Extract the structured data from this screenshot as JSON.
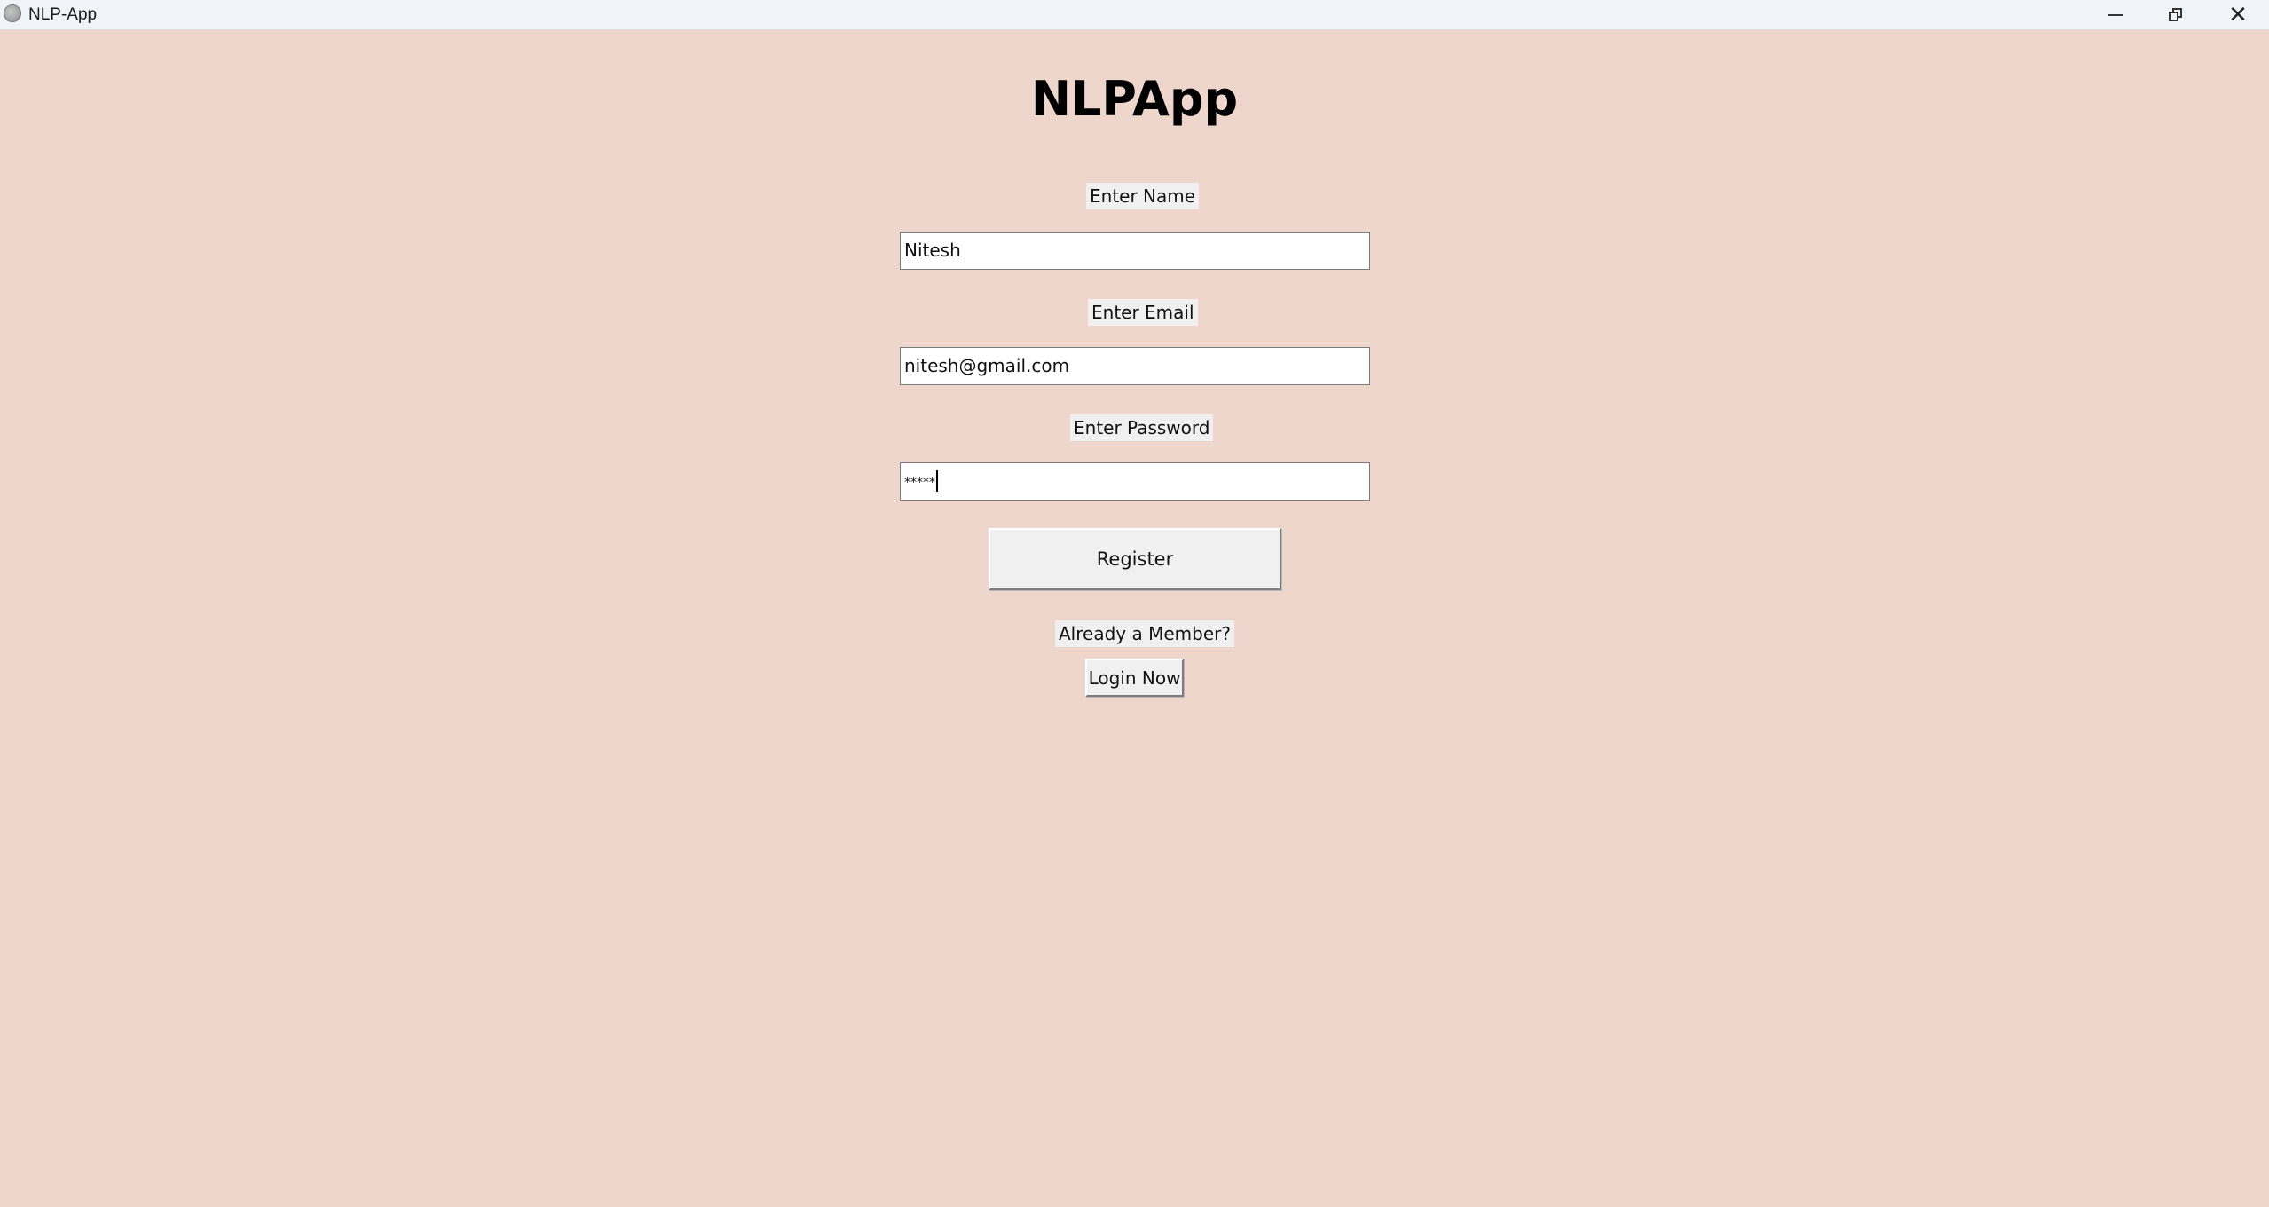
{
  "window": {
    "title": "NLP-App",
    "icon": "app-globe-icon",
    "controls": [
      "minimize-icon",
      "maximize-icon",
      "close-icon"
    ]
  },
  "main": {
    "heading": "NLPApp",
    "name_label": "Enter Name",
    "name_value": "Nitesh",
    "email_label": "Enter Email",
    "email_value": "nitesh@gmail.com",
    "password_label": "Enter Password",
    "password_value": "*****",
    "register_label": "Register",
    "member_prompt": "Already a Member?",
    "login_label": "Login Now"
  },
  "colors": {
    "background": "#eed6cc",
    "titlebar": "#f0f4f9",
    "button_face": "#f0f0f0"
  }
}
